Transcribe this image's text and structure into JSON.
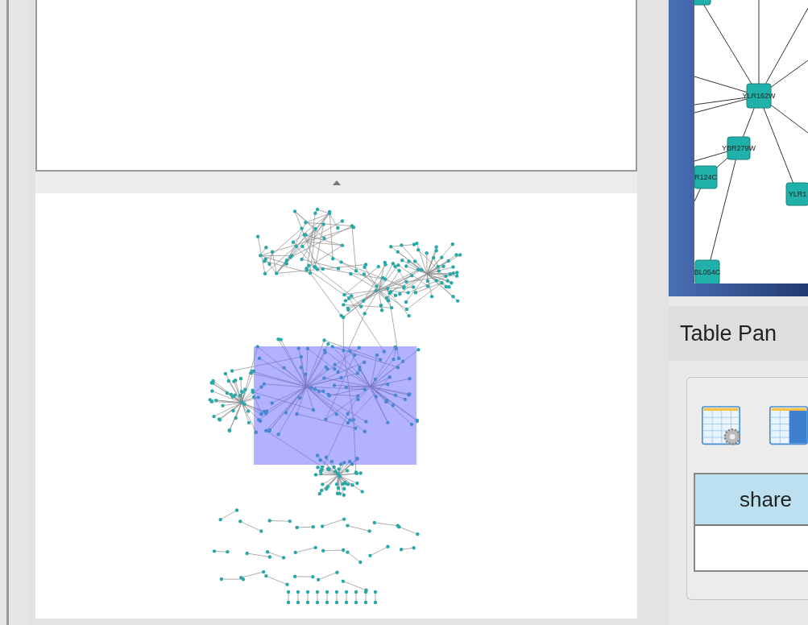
{
  "network_view": {
    "nodes": [
      {
        "label": "YLR162W"
      },
      {
        "label": "YBR279W"
      },
      {
        "label": "R124C"
      },
      {
        "label": "YLR1"
      },
      {
        "label": "BL054C"
      }
    ]
  },
  "table_panel": {
    "title": "Table Pan",
    "columns": [
      "share"
    ]
  }
}
